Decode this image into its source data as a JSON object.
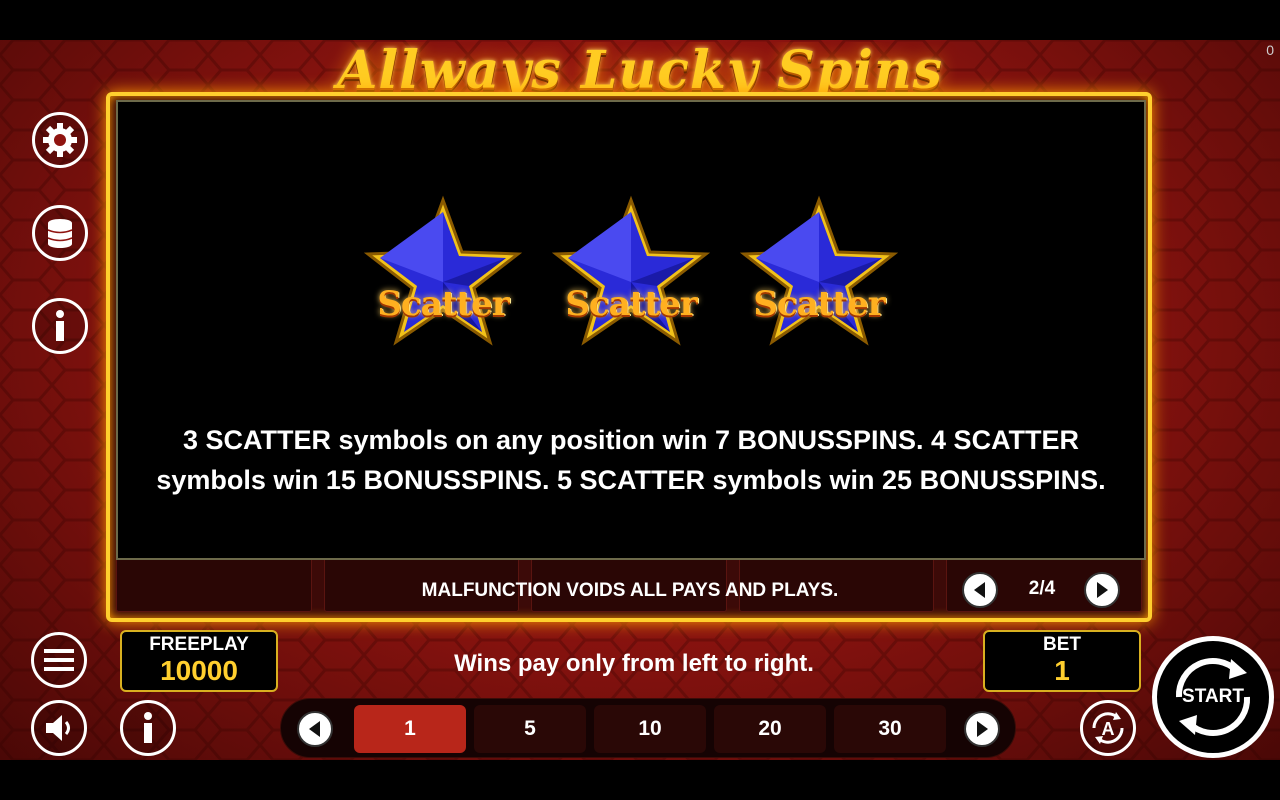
{
  "game": {
    "title": "Allways Lucky Spins",
    "corner_counter": "0"
  },
  "paytable": {
    "symbols": [
      {
        "icon": "scatter-star-icon",
        "label": "Scatter"
      },
      {
        "icon": "scatter-star-icon",
        "label": "Scatter"
      },
      {
        "icon": "scatter-star-icon",
        "label": "Scatter"
      }
    ],
    "rule_text": "3 SCATTER symbols on any position win 7 BONUSSPINS. 4 SCATTER symbols win 15 BONUSSPINS. 5 SCATTER symbols win 25 BONUSSPINS.",
    "footer_note": "MALFUNCTION VOIDS ALL PAYS AND PLAYS.",
    "page_indicator": "2/4"
  },
  "sidebar": {
    "icons": [
      "settings-gear-icon",
      "coins-stack-icon",
      "info-icon",
      "menu-icon",
      "sound-icon"
    ]
  },
  "balance": {
    "label": "FREEPLAY",
    "value": "10000"
  },
  "bet": {
    "label": "BET",
    "value": "1",
    "options": [
      "1",
      "5",
      "10",
      "20",
      "30"
    ],
    "selected": "1"
  },
  "wins_note": "Wins pay only from left to right.",
  "start_button": {
    "label": "START"
  },
  "colors": {
    "accent_gold": "#ffcf2e",
    "background_red": "#8f1410",
    "active_bet": "#b8261a",
    "star_blue": "#2a2ad8"
  }
}
